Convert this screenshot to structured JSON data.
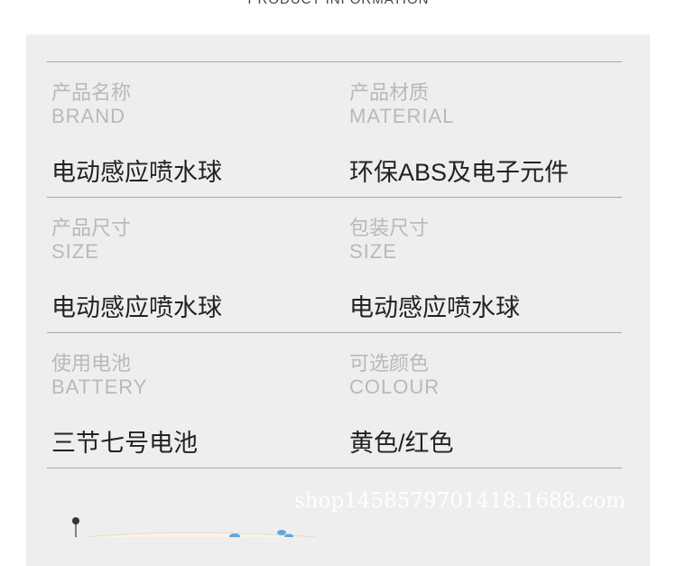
{
  "header": {
    "title": "PRODUCT INFORMATION"
  },
  "rows": [
    {
      "left": {
        "cn": "产品名称",
        "en": "BRAND",
        "value": "电动感应喷水球"
      },
      "right": {
        "cn": "产品材质",
        "en": "MATERIAL",
        "value": "环保ABS及电子元件"
      }
    },
    {
      "left": {
        "cn": "产品尺寸",
        "en": "SIZE",
        "value": "电动感应喷水球"
      },
      "right": {
        "cn": "包装尺寸",
        "en": "SIZE",
        "value": "电动感应喷水球"
      }
    },
    {
      "left": {
        "cn": "使用电池",
        "en": "BATTERY",
        "value": "三节七号电池"
      },
      "right": {
        "cn": "可选颜色",
        "en": "COLOUR",
        "value": "黄色/红色"
      }
    }
  ],
  "watermark": "shop1458579701418.1688.com",
  "colors": {
    "panel": "#eeeeee",
    "label": "#b9b9b9",
    "value": "#222222",
    "rule": "#a8a8a8",
    "accent_blue": "#5aa9e6"
  }
}
